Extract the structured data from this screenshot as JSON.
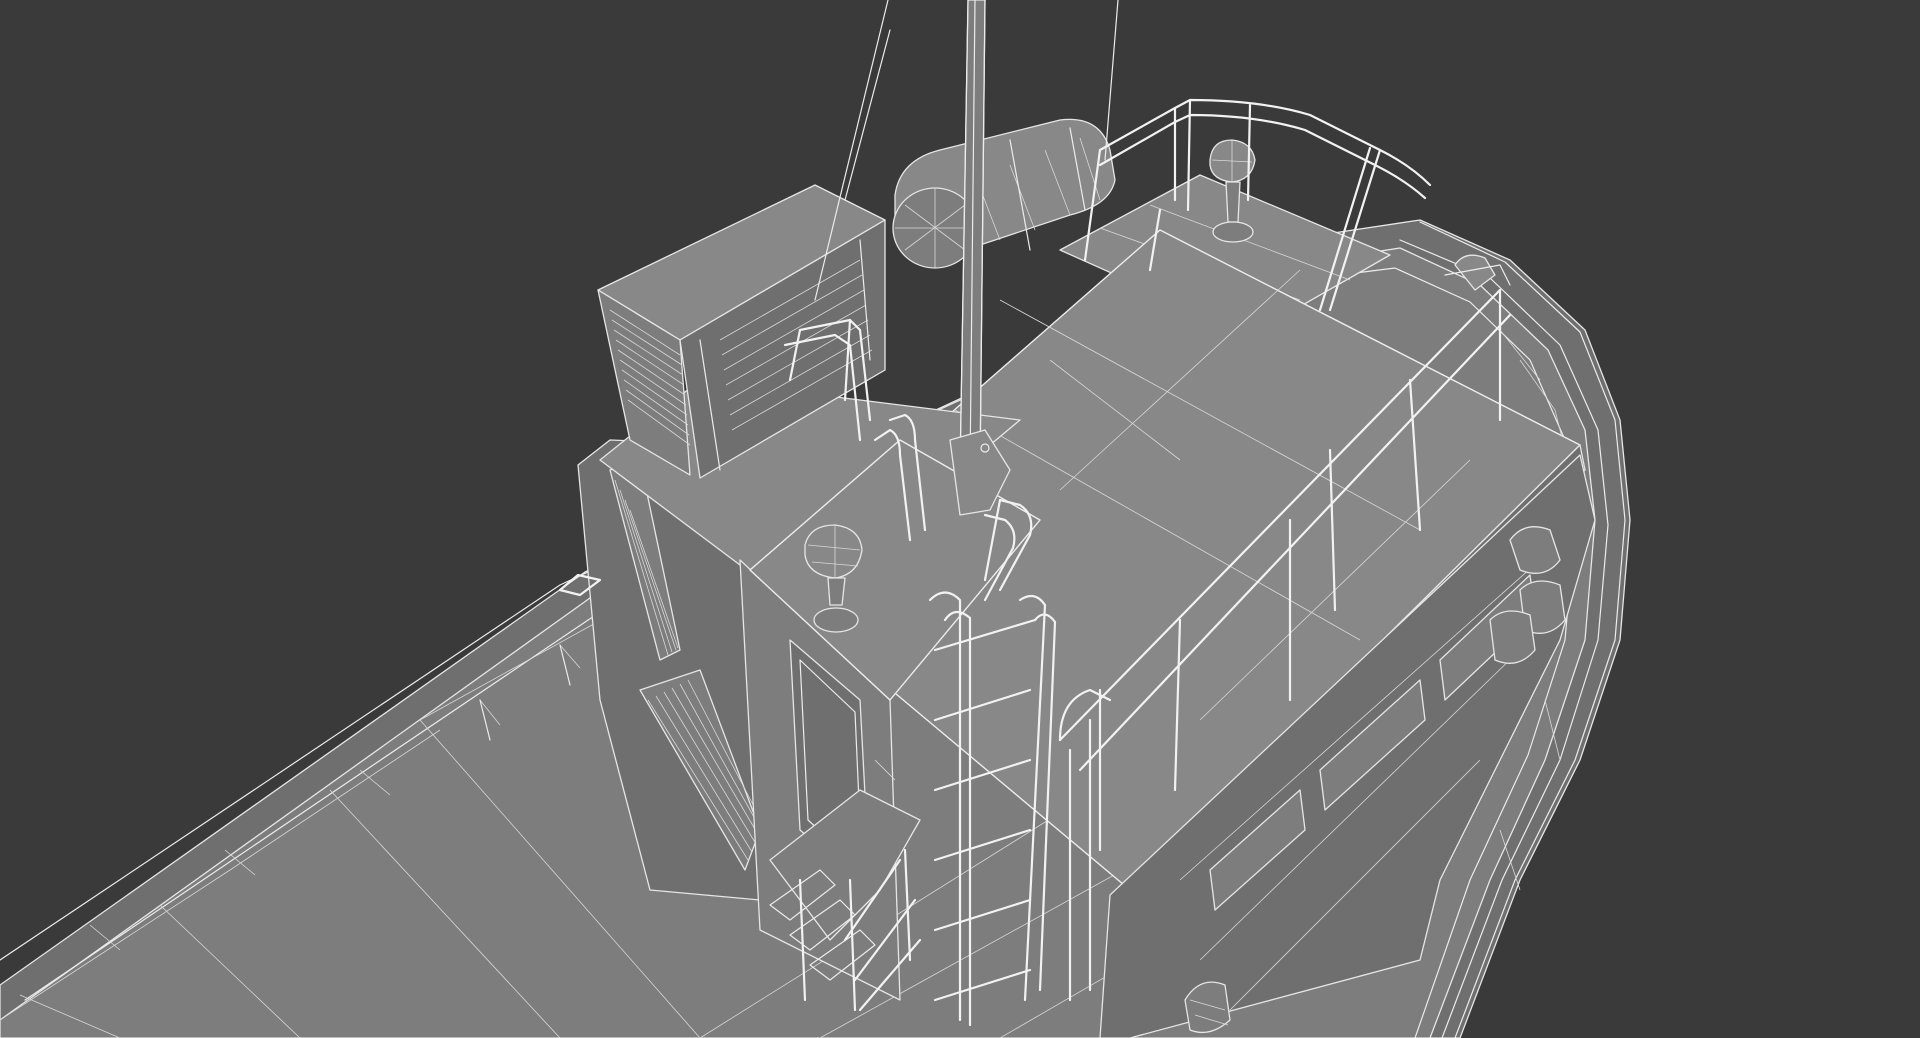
{
  "scene": {
    "subject": "boat-wireframe-model",
    "render_style": "wireframe-overlay-on-gray-shading",
    "colors": {
      "background": "#3a3a3a",
      "surface": "#7d7d7d",
      "wire": "#e6e6e6"
    }
  }
}
